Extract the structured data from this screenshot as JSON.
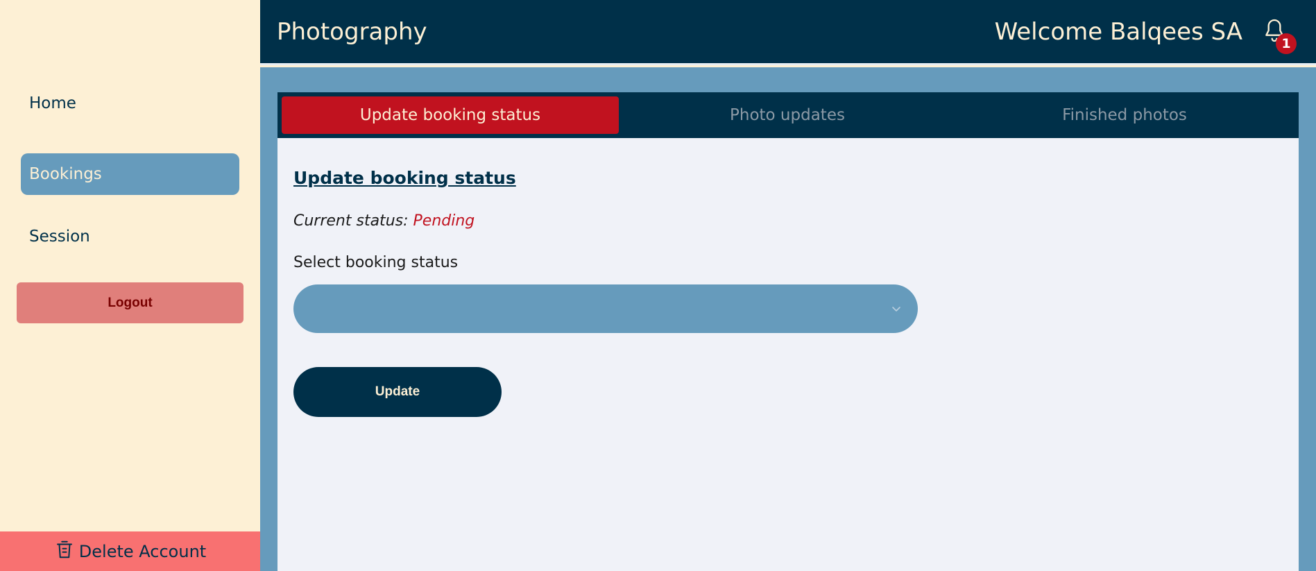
{
  "app": {
    "title": "Photography",
    "welcome": "Welcome Balqees SA"
  },
  "notifications": {
    "count": "1",
    "icon": "bell-icon"
  },
  "sidebar": {
    "items": [
      {
        "label": "Home",
        "active": false
      },
      {
        "label": "Bookings",
        "active": true
      },
      {
        "label": "Session",
        "active": false
      }
    ],
    "logout_label": "Logout",
    "delete_account_label": "Delete Account"
  },
  "tabs": [
    {
      "label": "Update booking status",
      "active": true
    },
    {
      "label": "Photo updates",
      "active": false
    },
    {
      "label": "Finished photos",
      "active": false
    }
  ],
  "form": {
    "title": "Update booking status",
    "current_status_label": "Current status:",
    "current_status_value": "Pending",
    "select_label": "Select booking status",
    "select_value": "",
    "submit_label": "Update"
  },
  "colors": {
    "navy": "#003049",
    "cream": "#fdf0d5",
    "steel_blue": "#669bbc",
    "red": "#c1121f",
    "logout_bg": "#e07f7b",
    "delete_bg": "#f87171"
  }
}
